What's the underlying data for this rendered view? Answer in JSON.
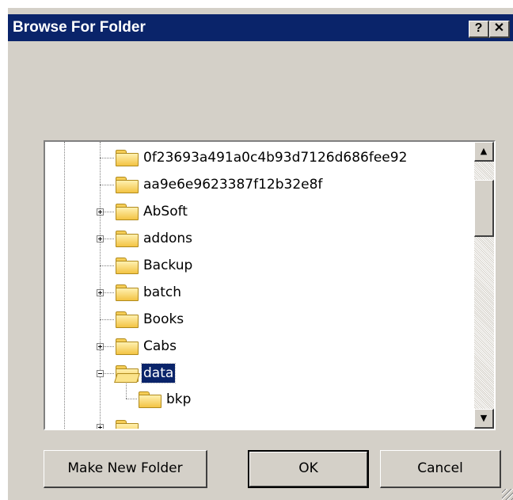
{
  "dialog": {
    "title": "Browse For Folder",
    "help_label": "?",
    "close_label": "✕"
  },
  "tree": {
    "items": [
      {
        "label": "0f23693a491a0c4b93d7126d686fee92",
        "has_children": false,
        "expanded": false,
        "selected": false
      },
      {
        "label": "aa9e6e9623387f12b32e8f",
        "has_children": false,
        "expanded": false,
        "selected": false
      },
      {
        "label": "AbSoft",
        "has_children": true,
        "expanded": false,
        "selected": false
      },
      {
        "label": "addons",
        "has_children": true,
        "expanded": false,
        "selected": false
      },
      {
        "label": "Backup",
        "has_children": false,
        "expanded": false,
        "selected": false
      },
      {
        "label": "batch",
        "has_children": true,
        "expanded": false,
        "selected": false
      },
      {
        "label": "Books",
        "has_children": false,
        "expanded": false,
        "selected": false
      },
      {
        "label": "Cabs",
        "has_children": true,
        "expanded": false,
        "selected": false
      },
      {
        "label": "data",
        "has_children": true,
        "expanded": true,
        "selected": true
      },
      {
        "label": "bkp",
        "has_children": false,
        "expanded": false,
        "selected": false
      }
    ]
  },
  "scrollbar": {
    "up_arrow": "▲",
    "down_arrow": "▼"
  },
  "buttons": {
    "make_new_folder": "Make New Folder",
    "ok": "OK",
    "cancel": "Cancel"
  },
  "colors": {
    "titlebar": "#0a246a",
    "selection": "#0a246a",
    "face": "#d4d0c8"
  }
}
